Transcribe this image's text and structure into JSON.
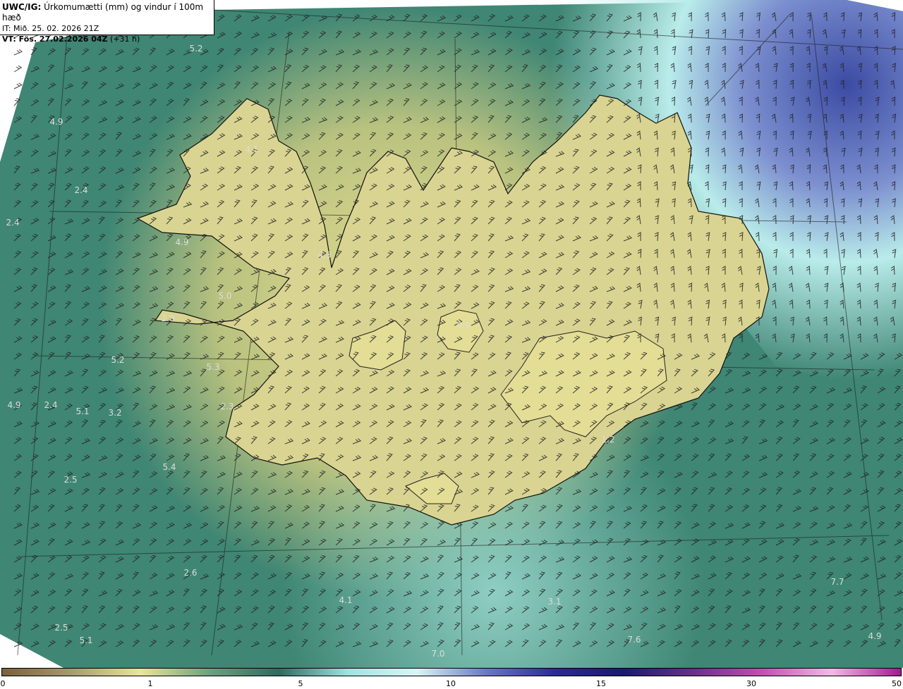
{
  "info": {
    "title_bold": "UWC/IG:",
    "title_rest": " Úrkomumætti (mm) og vindur í 100m hæð",
    "it_line": "IT: Mið. 25. 02. 2026 21Z",
    "vt_bold": "VT: Fös. 27.02.2026 04Z",
    "vt_rest": " (+31 h)"
  },
  "value_labels": [
    "5.2",
    "4.9",
    "4.1",
    "2.4",
    "2.4",
    "4.9",
    "4.3",
    "5.0",
    "2.0",
    "0.9",
    "5.2",
    "5.3",
    "4.9",
    "2.4",
    "5.1",
    "3.2",
    "2.3",
    "5.4",
    "2.5",
    "1.2",
    "2.6",
    "4.1",
    "3.1",
    "7.7",
    "2.5",
    "5.1",
    "7.0",
    "7.6",
    "4.9"
  ],
  "colorbar": {
    "ticks": [
      "0",
      "1",
      "5",
      "10",
      "15",
      "30",
      "50"
    ],
    "colors": [
      "#7a5f3c",
      "#a79a6e",
      "#e9e59a",
      "#6ea07e",
      "#2e6b5f",
      "#9fe3e3",
      "#d9f6f6",
      "#6b78c2",
      "#2a2a95",
      "#1a1a6e",
      "#6a2f8a",
      "#c24fb1",
      "#f4b9e6",
      "#a3198f"
    ]
  },
  "map": {
    "background_colors": {
      "sea": "#3f8674",
      "land": "#d6cf89",
      "cyan": "#a9e8e4",
      "blue": "#3f4ea4"
    }
  }
}
